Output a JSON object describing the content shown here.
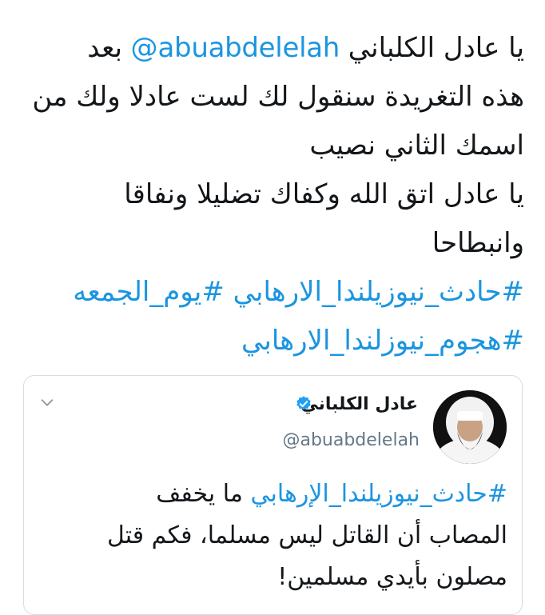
{
  "tweet": {
    "line1": {
      "lead": "يا عادل الكلباني ",
      "mention": "@abuabdelelah",
      "trail": " بعد"
    },
    "line2": "هذه التغريدة سنقول لك لست عادلا ولك من",
    "line3": "اسمك الثاني نصيب",
    "line4": "يا عادل اتق الله وكفاك تضليلا ونفاقا",
    "line5": "وانبطاحا",
    "hashtags_line1": "#حادث_نيوزيلندا_الارهابي #يوم_الجمعه",
    "hashtags_line2": "#هجوم_نيوزلندا_الارهابي"
  },
  "quoted_tweet": {
    "author_name": "عادل الكلباني",
    "handle": "@abuabdelelah",
    "verified_icon": "verified-badge-icon",
    "menu_icon": "chevron-down-icon",
    "line1": {
      "hashtag": "#حادث_نيوزيلندا_الإرهابي",
      "trail": " ما يخفف"
    },
    "line2": "المصاب أن القاتل ليس مسلما، فكم قتل",
    "line3": "مصلون بأيدي مسلمين!"
  },
  "colors": {
    "link": "#1b95e0",
    "text": "#14171a",
    "muted": "#657786",
    "border": "#d4dde3"
  }
}
